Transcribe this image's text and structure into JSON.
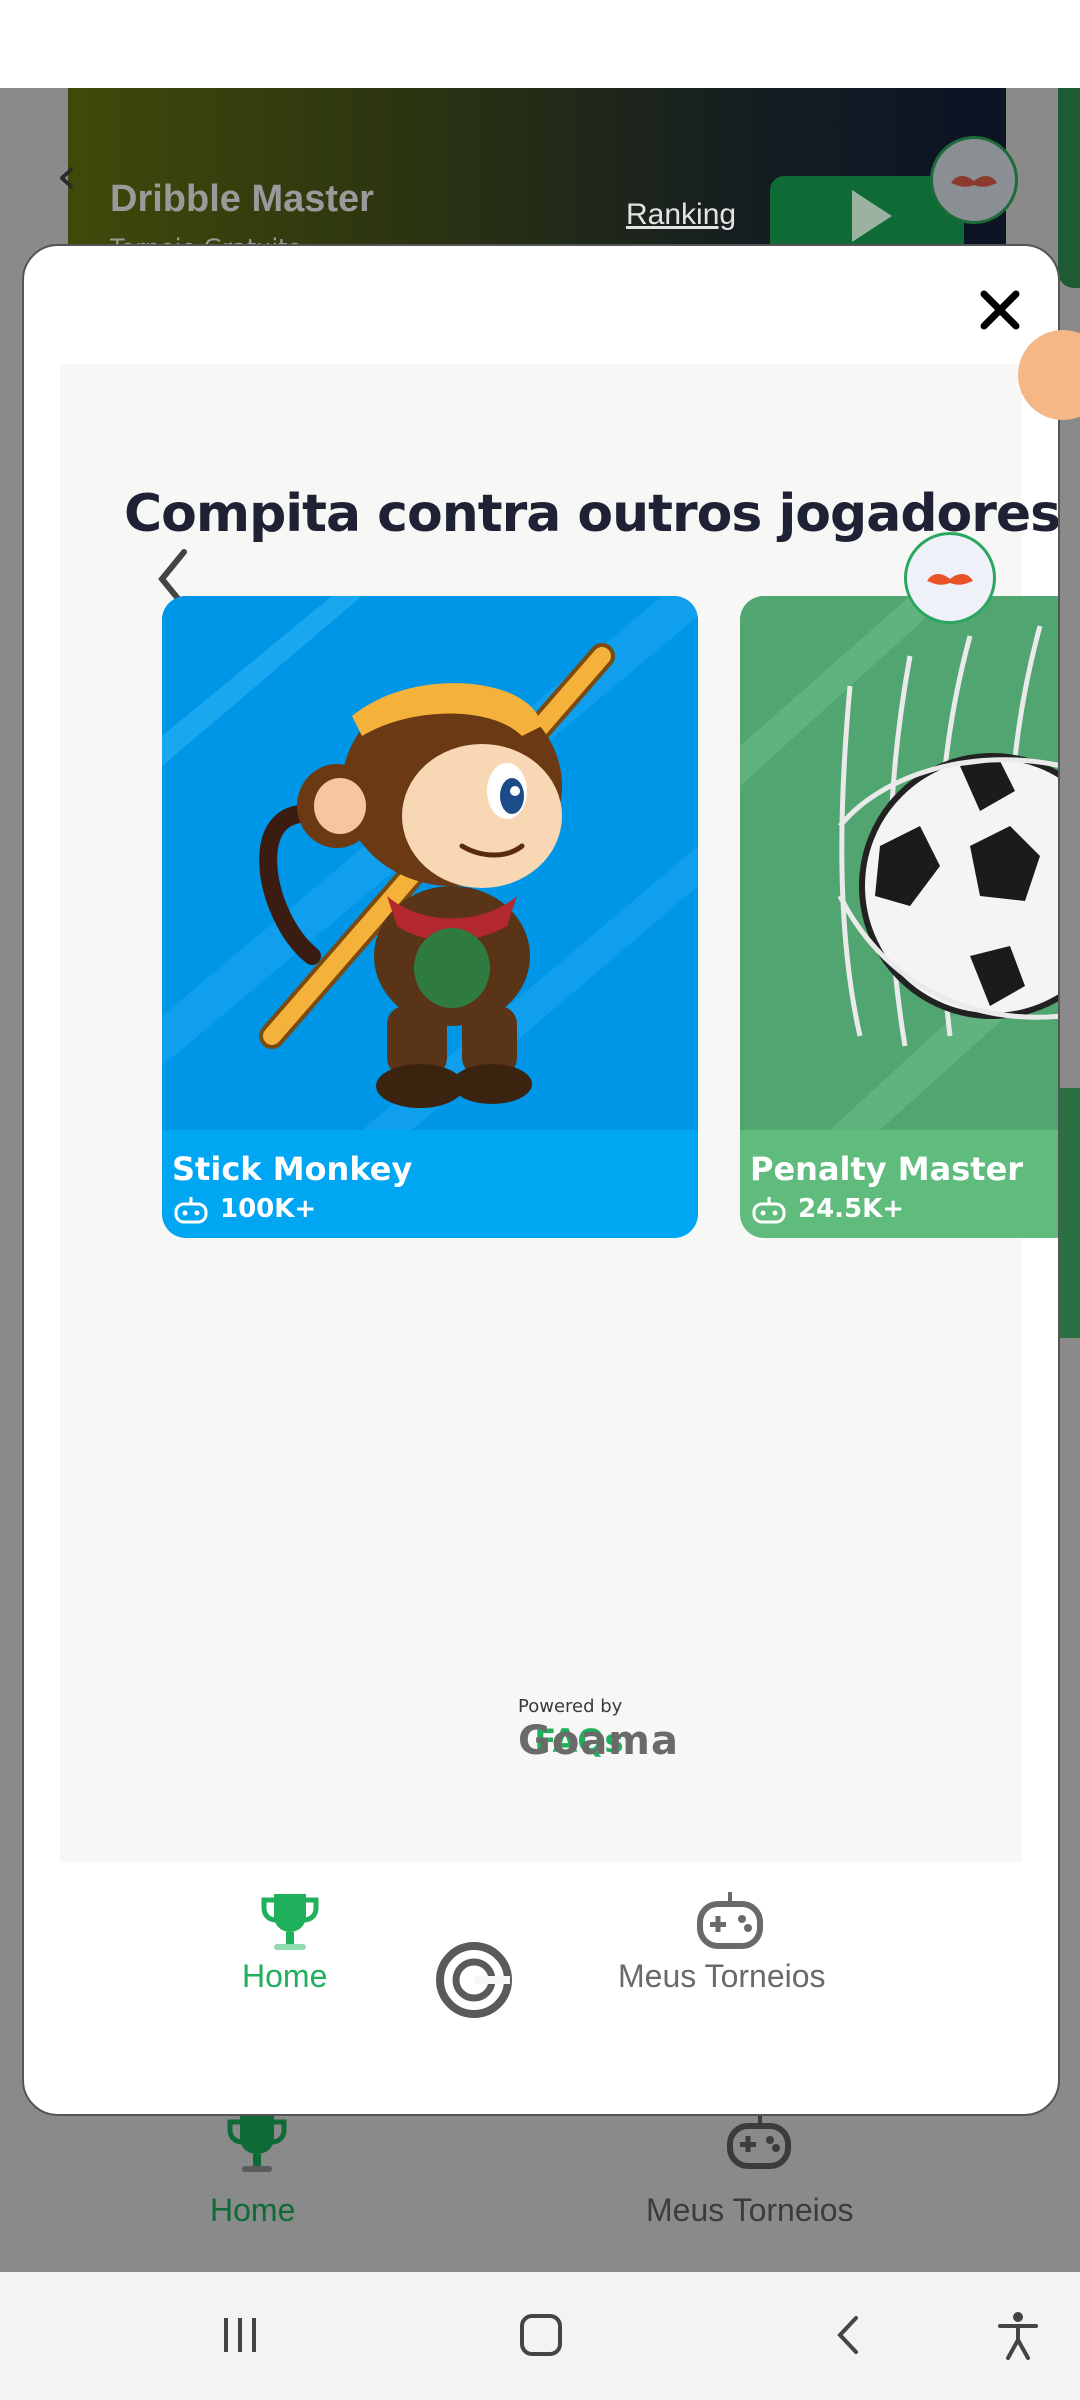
{
  "background_page": {
    "title": "Dribble Master",
    "subtitle": "Torneio Gratuito",
    "ranking_link": "Ranking",
    "bottom_nav": [
      {
        "label": "Home",
        "icon": "trophy-icon"
      },
      {
        "label": "Meus Torneios",
        "icon": "gamepad-icon"
      }
    ]
  },
  "modal": {
    "heading": "Compita contra outros jogadores",
    "games": [
      {
        "name": "Stick Monkey",
        "plays": "100K+",
        "icon": "gamepad-small-icon",
        "color": "#00a6f2"
      },
      {
        "name": "Penalty Master",
        "plays": "24.5K+",
        "icon": "gamepad-small-icon",
        "color": "#5fbc7d"
      }
    ],
    "faqs_label": "FAQs",
    "powered_by": "Powered by",
    "brand": "Goama",
    "bottom_nav": [
      {
        "label": "Home",
        "icon": "trophy-icon",
        "active": true
      },
      {
        "label": "Meus Torneios",
        "icon": "gamepad-icon",
        "active": false
      }
    ]
  },
  "colors": {
    "accent_green": "#1eb05a",
    "heading": "#1f2235",
    "inactive": "#6a6a6a"
  }
}
